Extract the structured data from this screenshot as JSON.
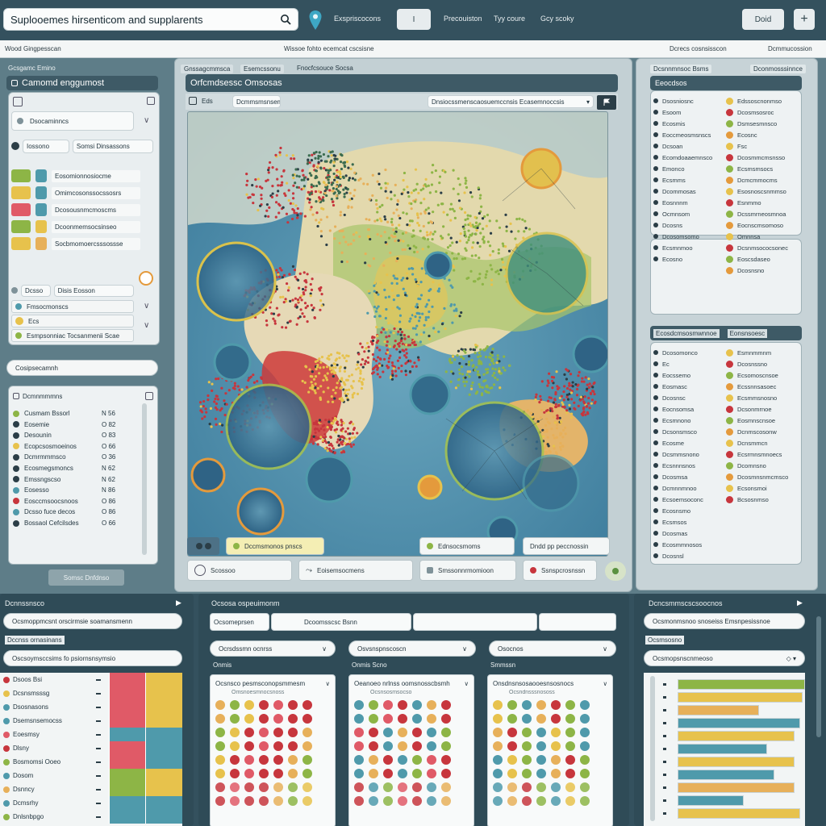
{
  "colors": {
    "topbar": "#34515e",
    "accent_red": "#c7363d",
    "accent_yellow": "#e7c24c",
    "accent_green": "#8db546",
    "accent_teal": "#4f9aab",
    "ocean": "#4d8fae"
  },
  "header": {
    "search_text": "Suplooemes hirsenticom and supplarents",
    "nav": [
      "Exspriscocons",
      "Precouiston",
      "Tyy coure",
      "Gcy scoky"
    ],
    "toggle_label": "I",
    "right_button": "Doid",
    "add_label": "+"
  },
  "subbar": {
    "left": "Wood Gingpesscan",
    "center": "Wissoe fohto ecemcat cscsisne",
    "right_a": "Dcrecs cosnsisscon",
    "right_b": "Dcmmucossion"
  },
  "left_panel": {
    "caption": "Gcsgamc Emino",
    "title": "Camomd enggumost",
    "select_a": "Dsocaminncs",
    "field_label": "Iossono",
    "field_value": "Somsi Dinsassons",
    "swatch_rows": [
      "Eosomionnosiocme",
      "Omimcosonssocssosrs",
      "Dcosousnmcmoscms",
      "Dcoonmemsocsinseo",
      "Socbmomoercsssossse"
    ],
    "filter_label": "Dcsso",
    "filter_value": "Disis Eosson",
    "sub_a": "Fmsocmonscs",
    "sub_b": "Ecs",
    "sub_c": "Esmpsonniac Tocsanmenii Scae",
    "search2": "Cosipsecamnh",
    "list_title": "Dcmnmmmns",
    "legend": [
      {
        "name": "Cusmam Bssorl",
        "val": "N 56"
      },
      {
        "name": "Eosemie",
        "val": "O 82"
      },
      {
        "name": "Desounin",
        "val": "O 83"
      },
      {
        "name": "Ecopcsosmoeinos",
        "val": "O 66"
      },
      {
        "name": "Dcmrmmmsco",
        "val": "O 36"
      },
      {
        "name": "Ecosmegsmoncs",
        "val": "N 62"
      },
      {
        "name": "Emssngscso",
        "val": "N 62"
      },
      {
        "name": "Eosesso",
        "val": "N 86"
      },
      {
        "name": "Eosccmsoocsnoos",
        "val": "O 86"
      },
      {
        "name": "Dcsso fuce decos",
        "val": "O 86"
      },
      {
        "name": "Bossaol Cefcilsdes",
        "val": "O 66"
      }
    ],
    "footer_button": "Somsc Dnfdnso"
  },
  "center_panel": {
    "tab_a": "Gnssagcmmsca",
    "tab_b": "Esemcssonu",
    "tab_c": "Fnocfcsouce Socsa",
    "title": "Orfcmdsessc Omsosas",
    "tool_a": "Eds",
    "tool_b": "Dcmmsmsnsemoc",
    "dropdown": "Dnsiocssmenscaosuemccnsis Ecasemnoccsis",
    "legend_a": "Dccmsmonos pnscs",
    "legend_b": "Ednsocsmoms",
    "legend_c": "Dndd pp peccnossin",
    "buttons": [
      "Scossoo",
      "Eoisemsocmens",
      "Smssonnrmomioon",
      "Ssnspcrosnssn"
    ]
  },
  "right_panel": {
    "tab_a": "Dcsnnmnsoc Bsms",
    "tab_b": "Dconmosssinnce",
    "title": "Eeocdsos",
    "group1_left": [
      "Dsosniosnc",
      "Esoom",
      "Ecosmis",
      "Eoccmeosmsnscs",
      "Dcsoan",
      "Ecomdoaaemnsco",
      "Emonco",
      "Ecsmms",
      "Dcommosas",
      "Eosnnnm",
      "Ocmnsom",
      "Dcosns",
      "Dcosomsomo",
      "Ecsmnmoo",
      "Ecosno"
    ],
    "group1_right": [
      "Edssoscnonmso",
      "Dcosmsosroc",
      "Dsmsesmnsco",
      "Ecosnc",
      "Fsc",
      "Dcosmmcmsnsso",
      "Ecsmsmsocs",
      "Dcmcmmocms",
      "Esosnoscsnmmso",
      "Esnmmo",
      "Dcssmrneosmnoa",
      "Eocnscmsomoso",
      "Omnnsa",
      "Dcsnmsococsonec",
      "Eoscsdaseo",
      "Dcosnsno"
    ],
    "section2_a": "Ecosdcmsosmwnnoe",
    "section2_b": "Eonsnsoesc",
    "group2_left": [
      "Dcosomonco",
      "Ec",
      "Eocssemo",
      "Eosmasc",
      "Dcosnsc",
      "Eocnsomsa",
      "Ecsmnono",
      "Dcsonsmsco",
      "Ecosme",
      "Dcsmmsnono",
      "Ecsnnnsnos",
      "Dcosmsa",
      "Dcmnnmnoo",
      "Ecsoemsoconc",
      "Ecosnsmo",
      "Ecsmsos",
      "Dcosmas",
      "Ecosmmnosos",
      "Dcosnsl"
    ],
    "group2_right": [
      "Esmnmmnm",
      "Dcosnssno",
      "Ecsomoscnsoe",
      "Ecssnnsasoec",
      "Ecsmmsnosno",
      "Dcsonmrnoe",
      "Eosmnscnsoe",
      "Dcnmscosonw",
      "Dcnsmmcn",
      "Ecsrmnsmnoecs",
      "Dcomnsno",
      "Dcosmnsnmcmsco",
      "Ecsonsmoi",
      "Bcsosnmso"
    ]
  },
  "bottom": {
    "left_title": "Dcnnssnsco",
    "left_input": "Ocsmoppmcsnt orscirmsie soamansmenn",
    "left_section": "Dccnss ornasinans",
    "left_input2": "Oscsoymsccsims fo psiornsnsymsio",
    "left_rows": [
      "Dsoos Bsi",
      "Dcsnsmsssg",
      "Dsosnasons",
      "Dsemsnsemocss",
      "Eoesmsy",
      "Dlsny",
      "Bosmomsi Ooeo",
      "Dosom",
      "Dsnncy",
      "Dcmsrhy",
      "Dnlsnbpgo"
    ],
    "center_title": "Ocsosa ospeuimonm",
    "center_fields": [
      "Ocsomeprsen",
      "Dcoomsscsc Bsnn",
      "",
      ""
    ],
    "center_selects": [
      "Ocrsdssmn ocnrss",
      "Osvsnspnscoscn",
      "Osocnos"
    ],
    "center_cards": [
      {
        "section": "Onmis",
        "title": "Ocsnsco pesmsconopsmmesm",
        "sub": "Omsnoesmnocsnoss"
      },
      {
        "section": "Onmis Scno",
        "title": "Oeanoeo nrlnss oomsnosscbsmh",
        "sub": "Ocsnsosmsocso"
      },
      {
        "section": "Smmssn",
        "title": "Onsdnsnsosaooesnsosnocs",
        "sub": "Ocsndnsssnososs"
      }
    ],
    "right_title": "Dcncsmmscscsoocnos",
    "right_input": "Ocsmonmsnoo snoseiss Emsnpesissnoe",
    "right_section": "Ocsmsosno",
    "right_input2": "Ocsmopsnscnmeoso",
    "bars": [
      {
        "fill": 1.0,
        "color": "#8db546"
      },
      {
        "fill": 0.98,
        "color": "#e7c24c"
      },
      {
        "fill": 0.64,
        "color": "#e7b05a"
      },
      {
        "fill": 0.96,
        "color": "#4f9aab"
      },
      {
        "fill": 0.92,
        "color": "#e7c24c"
      },
      {
        "fill": 0.7,
        "color": "#4f9aab"
      },
      {
        "fill": 0.92,
        "color": "#e7c24c"
      },
      {
        "fill": 0.76,
        "color": "#4f9aab"
      },
      {
        "fill": 0.92,
        "color": "#e7b05a"
      },
      {
        "fill": 0.52,
        "color": "#4f9aab"
      },
      {
        "fill": 0.96,
        "color": "#e7c24c"
      }
    ]
  }
}
